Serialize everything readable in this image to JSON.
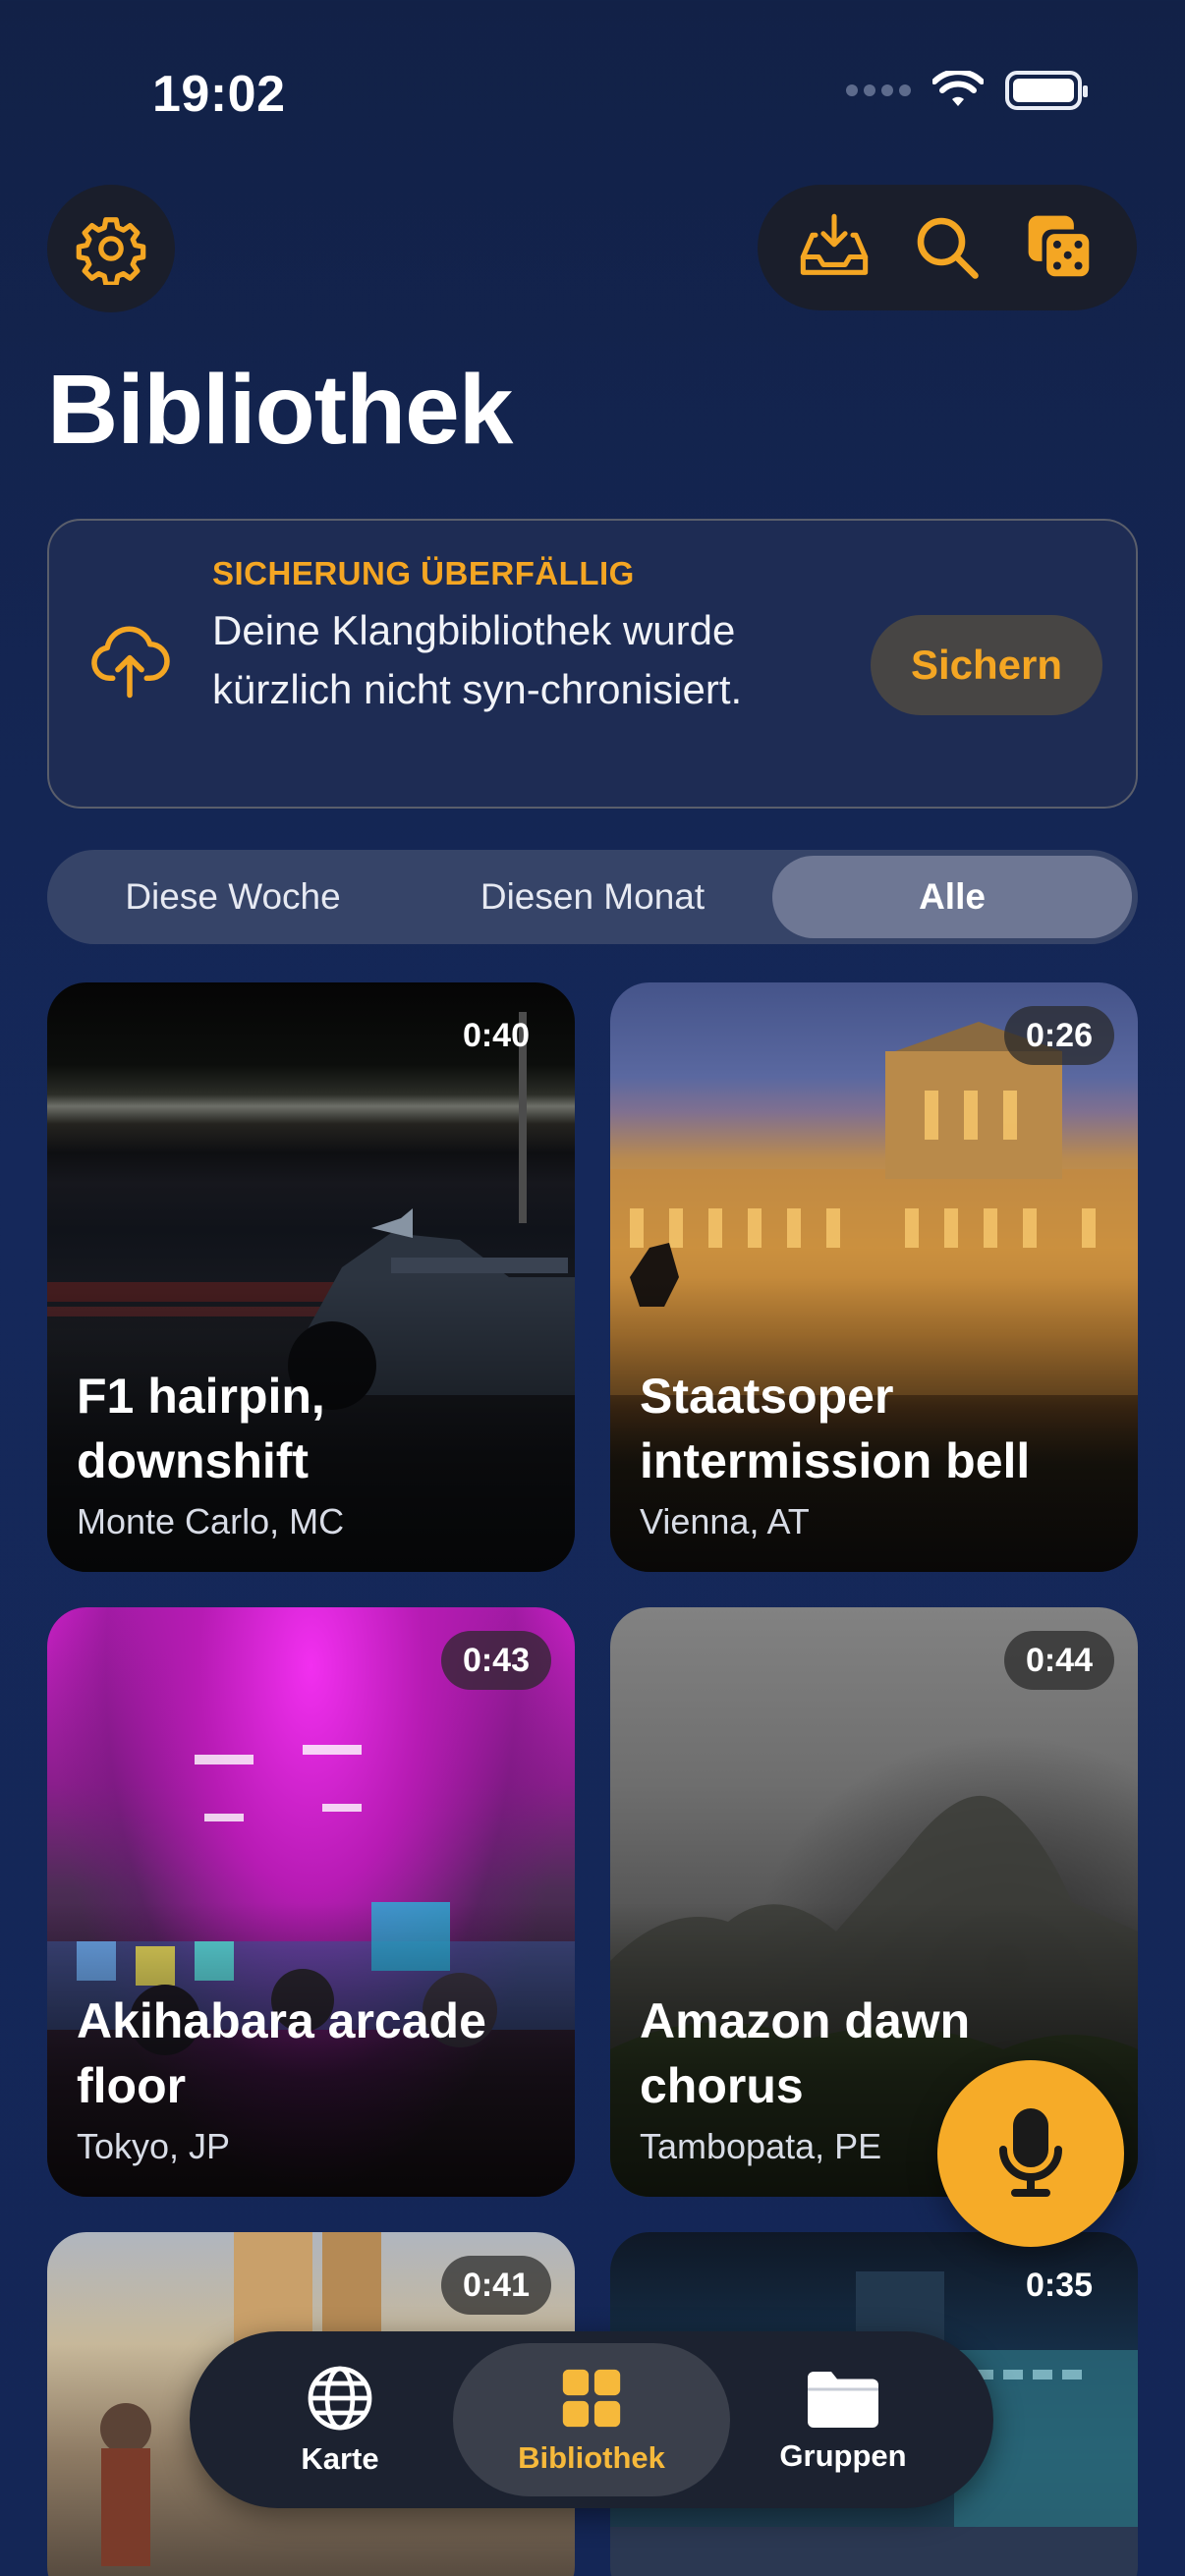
{
  "status_bar": {
    "time": "19:02"
  },
  "header": {
    "title": "Bibliothek"
  },
  "icons": {
    "settings": "gear-icon",
    "inbox": "inbox-download-icon",
    "search": "search-icon",
    "shuffle": "dice-icon"
  },
  "banner": {
    "label": "SICHERUNG ÜBERFÄLLIG",
    "text": "Deine Klangbibliothek wurde kürzlich nicht syn-chronisiert.",
    "button": "Sichern"
  },
  "filter": {
    "options": [
      "Diese Woche",
      "Diesen Monat",
      "Alle"
    ],
    "selected": "Alle"
  },
  "cards": [
    {
      "duration": "0:40",
      "title": "F1 hairpin, downshift",
      "location": "Monte Carlo, MC"
    },
    {
      "duration": "0:26",
      "title": "Staatsoper intermission bell",
      "location": "Vienna, AT"
    },
    {
      "duration": "0:43",
      "title": "Akihabara arcade floor",
      "location": "Tokyo, JP"
    },
    {
      "duration": "0:44",
      "title": "Amazon dawn chorus",
      "location": "Tambopata, PE"
    },
    {
      "duration": "0:41",
      "title": "",
      "location": ""
    },
    {
      "duration": "0:35",
      "title": "",
      "location": ""
    }
  ],
  "tabbar": {
    "items": [
      {
        "label": "Karte",
        "icon": "globe-icon"
      },
      {
        "label": "Bibliothek",
        "icon": "grid-icon"
      },
      {
        "label": "Gruppen",
        "icon": "folder-icon"
      }
    ],
    "active": "Bibliothek"
  },
  "colors": {
    "accent": "#f4a623",
    "background": "#15285a"
  }
}
